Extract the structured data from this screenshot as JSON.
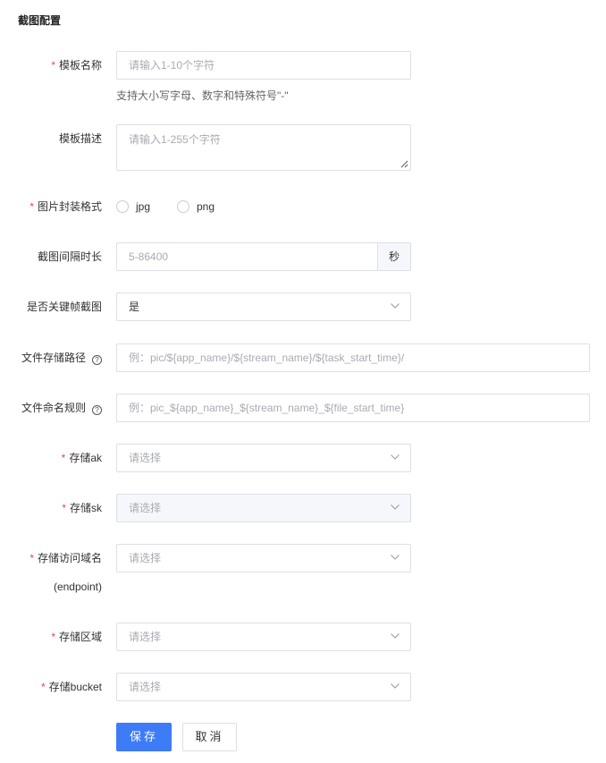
{
  "section": {
    "title": "截图配置"
  },
  "required_mark": "*",
  "help_mark": "?",
  "fields": {
    "template_name": {
      "label": "模板名称",
      "placeholder": "请输入1-10个字符",
      "hint": "支持大小写字母、数字和特殊符号\"-\""
    },
    "template_desc": {
      "label": "模板描述",
      "placeholder": "请输入1-255个字符"
    },
    "image_format": {
      "label": "图片封装格式",
      "options": [
        "jpg",
        "png"
      ]
    },
    "interval": {
      "label": "截图间隔时长",
      "placeholder": "5-86400",
      "suffix": "秒"
    },
    "keyframe": {
      "label": "是否关键帧截图",
      "value": "是"
    },
    "storage_path": {
      "label": "文件存储路径",
      "placeholder": "例：pic/${app_name}/${stream_name}/${task_start_time}/"
    },
    "naming_rule": {
      "label": "文件命名规则",
      "placeholder": "例：pic_${app_name}_${stream_name}_${file_start_time}"
    },
    "storage_ak": {
      "label": "存储ak",
      "placeholder": "请选择"
    },
    "storage_sk": {
      "label": "存储sk",
      "placeholder": "请选择"
    },
    "storage_domain": {
      "label": "存储访问域名",
      "label_line2": "(endpoint)",
      "placeholder": "请选择"
    },
    "storage_region": {
      "label": "存储区域",
      "placeholder": "请选择"
    },
    "storage_bucket": {
      "label": "存储bucket",
      "placeholder": "请选择"
    }
  },
  "actions": {
    "save": "保存",
    "cancel": "取消"
  },
  "colors": {
    "primary": "#3d7bf7",
    "required": "#e5484d",
    "border": "#dcdfe6"
  }
}
